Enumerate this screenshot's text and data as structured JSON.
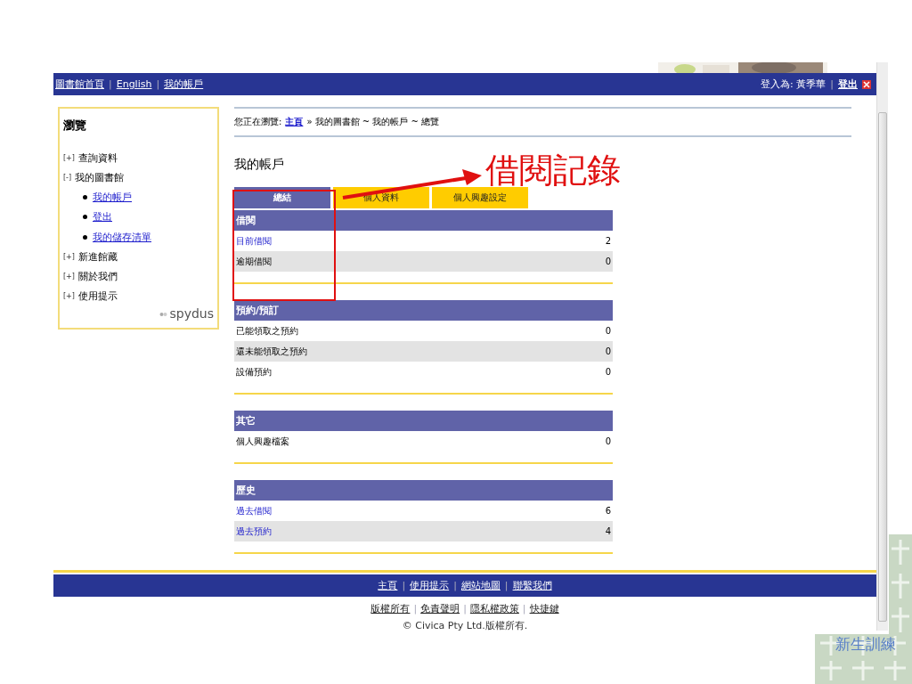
{
  "top_bar": {
    "separator": "|",
    "links": [
      "圖書館首頁",
      "English",
      "我的帳戶"
    ],
    "login_label": "登入為: 黃季華",
    "logout": "登出"
  },
  "sidebar": {
    "title": "瀏覽",
    "items": [
      {
        "toggle": "[+]",
        "label": "查詢資料"
      },
      {
        "toggle": "[-]",
        "label": "我的圖書館",
        "children": [
          {
            "label": "我的帳戶"
          },
          {
            "label": "登出"
          },
          {
            "label": "我的儲存清單"
          }
        ]
      },
      {
        "toggle": "[+]",
        "label": "新進館藏"
      },
      {
        "toggle": "[+]",
        "label": "關於我們"
      },
      {
        "toggle": "[+]",
        "label": "使用提示"
      }
    ],
    "logo": "spydus"
  },
  "breadcrumb": {
    "prefix": "您正在瀏覽:",
    "link": "主頁",
    "rest": "» 我的圖書館 ~ 我的帳戶 ~ 總覽"
  },
  "heading": "我的帳戶",
  "tabs": [
    {
      "label": "總結",
      "selected": true
    },
    {
      "label": "個人資料",
      "selected": false
    },
    {
      "label": "個人興趣設定",
      "selected": false
    }
  ],
  "sections": [
    {
      "title": "借閱",
      "rows": [
        {
          "label": "目前借閱",
          "value": "2",
          "link": true
        },
        {
          "label": "逾期借閱",
          "value": "0",
          "link": false
        }
      ]
    },
    {
      "title": "預約/預訂",
      "rows": [
        {
          "label": "已能領取之預約",
          "value": "0",
          "link": false
        },
        {
          "label": "還未能領取之預約",
          "value": "0",
          "link": false
        },
        {
          "label": "設備預約",
          "value": "0",
          "link": false
        }
      ]
    },
    {
      "title": "其它",
      "rows": [
        {
          "label": "個人興趣檔案",
          "value": "0",
          "link": false
        }
      ]
    },
    {
      "title": "歷史",
      "rows": [
        {
          "label": "過去借閱",
          "value": "6",
          "link": true
        },
        {
          "label": "過去預約",
          "value": "4",
          "link": true
        }
      ]
    }
  ],
  "footer": {
    "separator": "|",
    "nav": [
      "主頁",
      "使用提示",
      "網站地圖",
      "聯繫我們"
    ],
    "links": [
      "版權所有",
      "免責聲明",
      "隱私權政策",
      "快捷鍵"
    ],
    "copyright": "© Civica Pty Ltd.版權所有."
  },
  "annotation": {
    "text": "借閱記錄"
  },
  "slide_title": "新生訓練"
}
